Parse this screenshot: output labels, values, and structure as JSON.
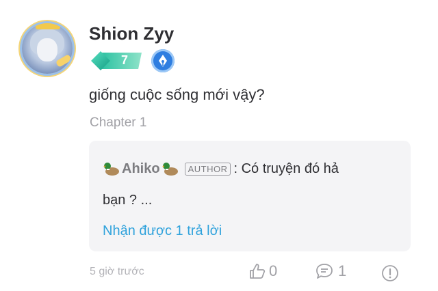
{
  "user": {
    "name": "Shion Zyy",
    "level": "7"
  },
  "comment": {
    "text": "giống cuộc sống mới vậy?",
    "chapter": "Chapter 1"
  },
  "reply": {
    "author": "Ahiko",
    "author_tag": "AUTHOR",
    "text_line1": ": Có truyện đó hả",
    "text_line2": "bạn ? ...",
    "more_link": "Nhận được 1 trả lời"
  },
  "footer": {
    "time": "5 giờ trước",
    "likes": "0",
    "replies": "1"
  },
  "colors": {
    "link": "#2fa2dc",
    "level": "#28c0a0",
    "pen_badge": "#2f7ee0"
  }
}
